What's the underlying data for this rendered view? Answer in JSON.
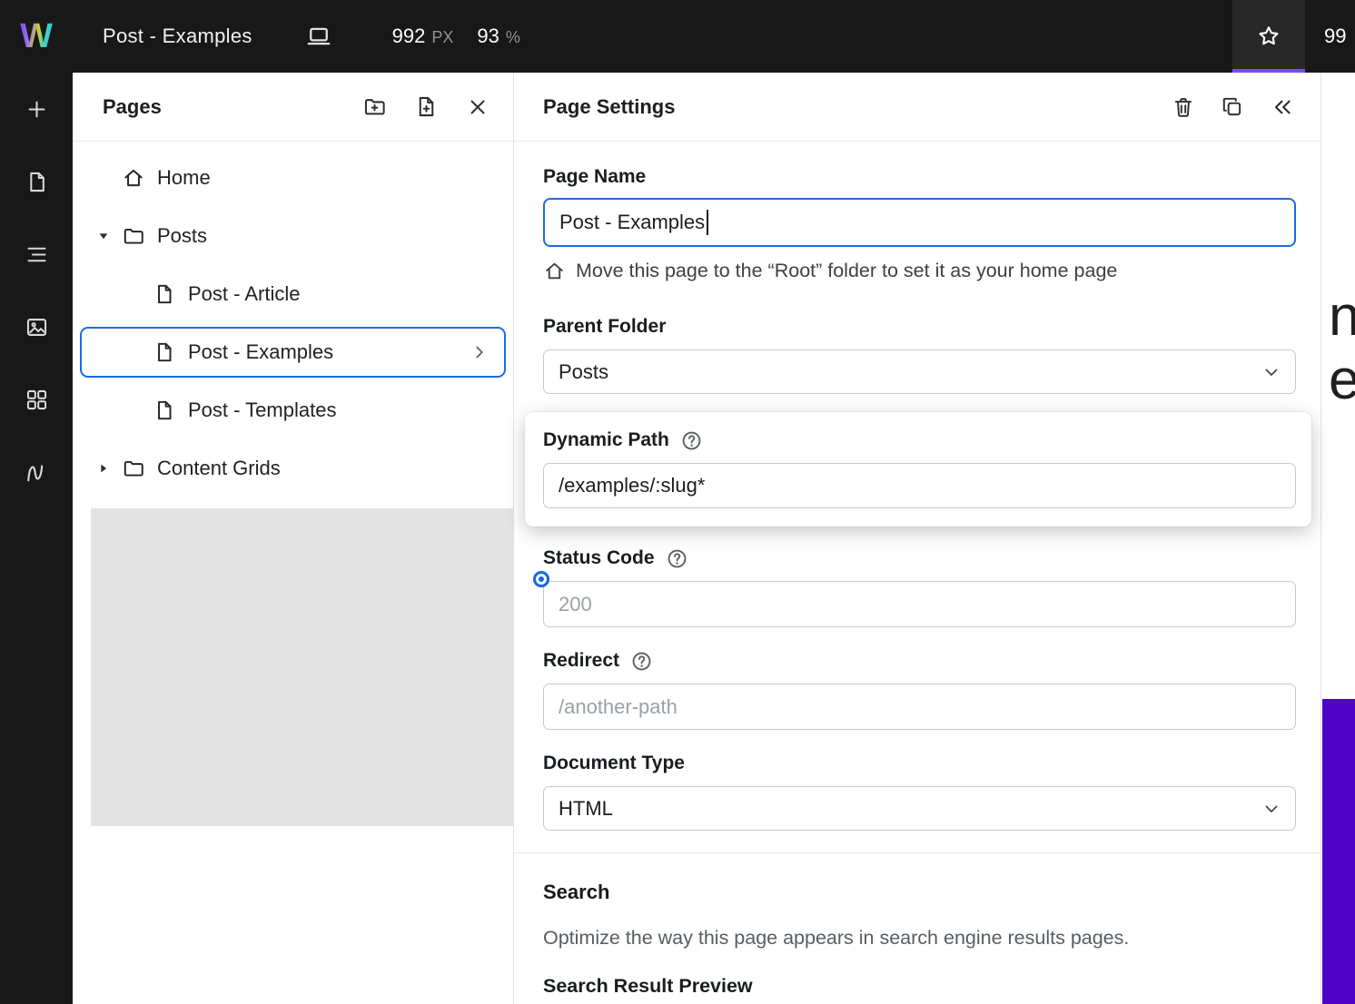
{
  "topbar": {
    "logo_letter": "W",
    "title": "Post - Examples",
    "canvas_width": "992",
    "canvas_width_unit": "PX",
    "zoom": "93",
    "zoom_unit": "%",
    "clipped_right_text": "99"
  },
  "pages_panel": {
    "title": "Pages",
    "tree": [
      {
        "label": "Home"
      },
      {
        "label": "Posts"
      },
      {
        "label": "Post - Article"
      },
      {
        "label": "Post - Examples"
      },
      {
        "label": "Post - Templates"
      },
      {
        "label": "Content Grids"
      }
    ]
  },
  "settings": {
    "title": "Page Settings",
    "page_name_label": "Page Name",
    "page_name_value": "Post - Examples",
    "home_hint": "Move this page to the “Root” folder to set it as your home page",
    "parent_folder_label": "Parent Folder",
    "parent_folder_value": "Posts",
    "dynamic_path_label": "Dynamic Path",
    "dynamic_path_value": "/examples/:slug*",
    "status_code_label": "Status Code",
    "status_code_placeholder": "200",
    "redirect_label": "Redirect",
    "redirect_placeholder": "/another-path",
    "document_type_label": "Document Type",
    "document_type_value": "HTML",
    "search_title": "Search",
    "search_description": "Optimize the way this page appears in search engine results pages.",
    "search_preview_label": "Search Result Preview"
  },
  "canvas": {
    "partial_text_lines": [
      "n",
      "e"
    ],
    "accent_block_color": "#4e05c9"
  },
  "colors": {
    "focus_blue": "#1a6ce8",
    "topbar_bg": "#181818",
    "tab_underline": "#7b49f5"
  }
}
